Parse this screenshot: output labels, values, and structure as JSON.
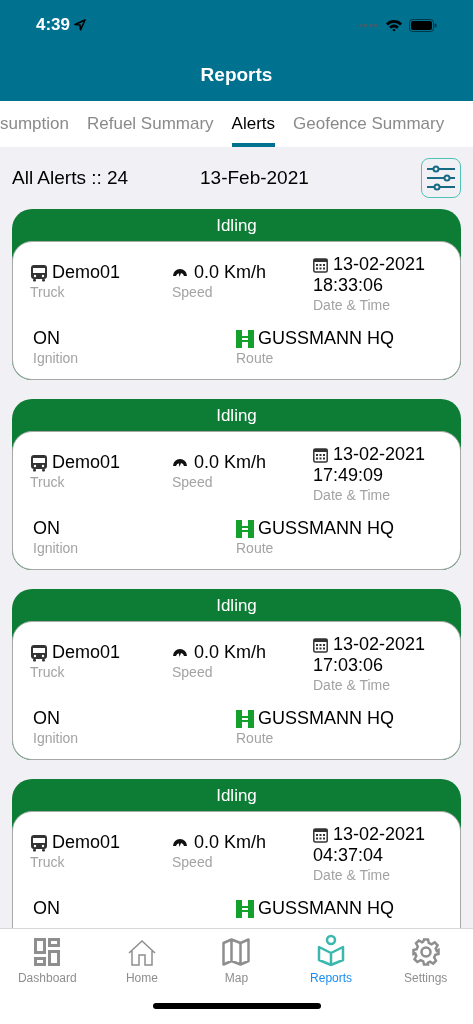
{
  "status_bar": {
    "time": "4:39"
  },
  "header": {
    "title": "Reports"
  },
  "tabs": [
    {
      "label": "sumption",
      "selected": false
    },
    {
      "label": "Refuel Summary",
      "selected": false
    },
    {
      "label": "Alerts",
      "selected": true
    },
    {
      "label": "Geofence Summary",
      "selected": false
    }
  ],
  "summary": {
    "count_label": "All Alerts :: 24",
    "date": "13-Feb-2021"
  },
  "alerts": [
    {
      "type": "Idling",
      "vehicle": "Demo01",
      "vehicle_label": "Truck",
      "speed": "0.0 Km/h",
      "speed_label": "Speed",
      "date": "13-02-2021",
      "time": "18:33:06",
      "datetime_label": "Date & Time",
      "ignition": "ON",
      "ignition_label": "Ignition",
      "route": "GUSSMANN HQ",
      "route_label": "Route"
    },
    {
      "type": "Idling",
      "vehicle": "Demo01",
      "vehicle_label": "Truck",
      "speed": "0.0 Km/h",
      "speed_label": "Speed",
      "date": "13-02-2021",
      "time": "17:49:09",
      "datetime_label": "Date & Time",
      "ignition": "ON",
      "ignition_label": "Ignition",
      "route": "GUSSMANN HQ",
      "route_label": "Route"
    },
    {
      "type": "Idling",
      "vehicle": "Demo01",
      "vehicle_label": "Truck",
      "speed": "0.0 Km/h",
      "speed_label": "Speed",
      "date": "13-02-2021",
      "time": "17:03:06",
      "datetime_label": "Date & Time",
      "ignition": "ON",
      "ignition_label": "Ignition",
      "route": "GUSSMANN HQ",
      "route_label": "Route"
    },
    {
      "type": "Idling",
      "vehicle": "Demo01",
      "vehicle_label": "Truck",
      "speed": "0.0 Km/h",
      "speed_label": "Speed",
      "date": "13-02-2021",
      "time": "04:37:04",
      "datetime_label": "Date & Time",
      "ignition": "ON",
      "route": "GUSSMANN HQ"
    }
  ],
  "tab_bar": [
    {
      "label": "Dashboard",
      "selected": false
    },
    {
      "label": "Home",
      "selected": false
    },
    {
      "label": "Map",
      "selected": false
    },
    {
      "label": "Reports",
      "selected": true
    },
    {
      "label": "Settings",
      "selected": false
    }
  ]
}
